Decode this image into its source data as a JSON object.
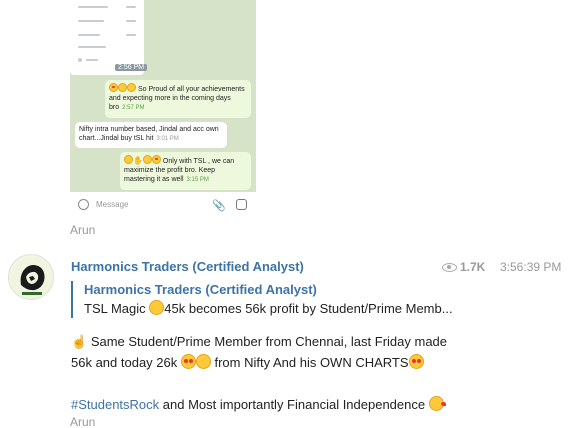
{
  "screenshot": {
    "time_label": "2:56 PM",
    "messages": [
      {
        "direction": "out",
        "text": "So Proud of all your achievements and expecting more in the coming days bro",
        "time": "2:57 PM"
      },
      {
        "direction": "in",
        "text": "Nifty intra number based, Jindal and acc own chart...Jindal buy tSL hit",
        "time": "3:01 PM"
      },
      {
        "direction": "out",
        "text": "Only with TSL , we can maximize the profit bro. Keep mastering it as well",
        "time": "3:15 PM"
      }
    ],
    "input_placeholder": "Message"
  },
  "signature_top": "Arun",
  "post": {
    "channel_name": "Harmonics Traders (Certified Analyst)",
    "views": "1.7K",
    "time": "3:56:39 PM",
    "reply": {
      "name": "Harmonics Traders (Certified Analyst)",
      "text_before": "TSL Magic ",
      "text_after": "45k becomes 56k profit by Student/Prime Memb..."
    },
    "line1": "Same Student/Prime Member from Chennai, last Friday made",
    "line2_before": "56k and today 26k ",
    "line2_after": " from Nifty And his OWN CHARTS",
    "hashtag": "#StudentsRock",
    "line3_after": " and Most importantly Financial Independence ",
    "signature": "Arun"
  },
  "icons": [
    "emoji-icon",
    "attach-icon",
    "camera-icon",
    "eye-icon",
    "avatar-lion-logo"
  ]
}
